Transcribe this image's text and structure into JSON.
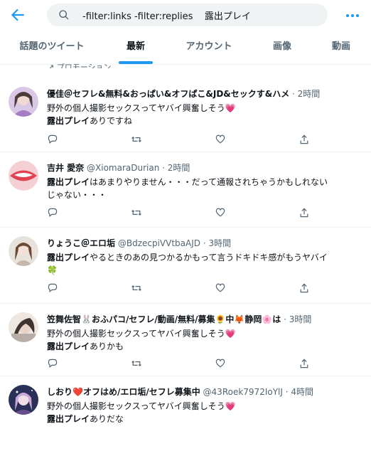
{
  "search": {
    "query": "-filter:links -filter:replies    露出プレイ"
  },
  "tabs": [
    {
      "label": "話題のツイート"
    },
    {
      "label": "最新"
    },
    {
      "label": "アカウント"
    },
    {
      "label": "画像"
    },
    {
      "label": "動画"
    }
  ],
  "promo_label": "プロモーション",
  "tweets": [
    {
      "name": "優佳＠セフレ&無料&おっぱい&オフぱこ&JD&セックす&ハメ",
      "handle": "",
      "time": "2時間",
      "line1": "野外の個人撮影セックスってヤバイ興奮しそう",
      "line1_emoji": "💗",
      "line2_hl": "露出プレイ",
      "line2_rest": "ありですね"
    },
    {
      "name": "吉井 愛奈",
      "handle": "@XiomaraDurian",
      "time": "2時間",
      "line1_hl": "露出プレイ",
      "line1_rest": "はあまりやりません・・・だって通報されちゃうかもしれない",
      "line2": "じゃない・・・"
    },
    {
      "name": "りょうこ＠エロ垢",
      "handle": "@BdzecpiVVtbaAJD",
      "time": "3時間",
      "line1_hl": "露出プレイ",
      "line1_rest": "やるときのあの見つかるかもって言うドキドキ感がもうヤバイ",
      "line2": "🍀"
    },
    {
      "name": "笠舞佐智🐰おふパコ/セフレ/動画/無料/募集🌻中🦊静岡🌸は",
      "handle": "",
      "time": "3時間",
      "line1": "野外の個人撮影セックスってヤバイ興奮しそう",
      "line1_emoji": "💗",
      "line2_hl": "露出プレイ",
      "line2_rest": "ありかも"
    },
    {
      "name": "しおり❤️オフはめ/エロ垢/セフレ募集中",
      "handle": "@43Roek7972IoYlJ",
      "time": "4時間",
      "line1": "野外の個人撮影セックスってヤバイ興奮しそう",
      "line1_emoji": "💗",
      "line2_hl": "露出プレイ",
      "line2_rest": "ありだな"
    }
  ],
  "colors": {
    "accent": "#1d9bf0",
    "muted": "#536471",
    "text": "#0f1419"
  }
}
